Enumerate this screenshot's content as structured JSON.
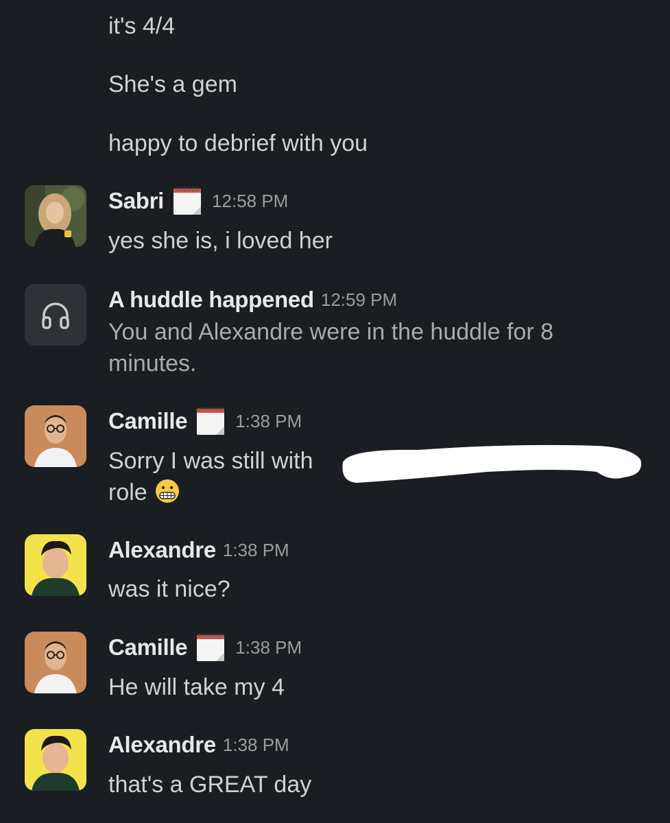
{
  "continued_messages": [
    {
      "text": "it's 4/4"
    },
    {
      "text": "She's a gem"
    },
    {
      "text": "happy to debrief with you"
    }
  ],
  "messages": [
    {
      "sender": "Sabri",
      "time": "12:58 PM",
      "has_status_icon": true,
      "status_icon": "calendar-icon",
      "lines": [
        "yes she is, i loved her"
      ]
    },
    {
      "sender": "A huddle happened",
      "time": "12:59 PM",
      "icon": "headphones-icon",
      "lines": [
        "You and Alexandre were in the huddle for 8",
        "minutes."
      ]
    },
    {
      "sender": "Camille",
      "time": "1:38 PM",
      "has_status_icon": true,
      "status_icon": "calendar-icon",
      "lines": [
        "Sorry I was still with",
        "role"
      ],
      "emoji": "grimacing-face-emoji"
    },
    {
      "sender": "Alexandre",
      "time": "1:38 PM",
      "lines": [
        "was it nice?"
      ]
    },
    {
      "sender": "Camille",
      "time": "1:38 PM",
      "has_status_icon": true,
      "status_icon": "calendar-icon",
      "lines": [
        "He will take my 4"
      ]
    },
    {
      "sender": "Alexandre",
      "time": "1:38 PM",
      "lines": [
        "that's a GREAT day"
      ]
    }
  ],
  "colors": {
    "background": "#1a1d21",
    "text": "#d1d2d3",
    "timestamp": "#9b9c9e",
    "huddle_icon_bg": "#2e3136",
    "redaction": "#ffffff"
  }
}
